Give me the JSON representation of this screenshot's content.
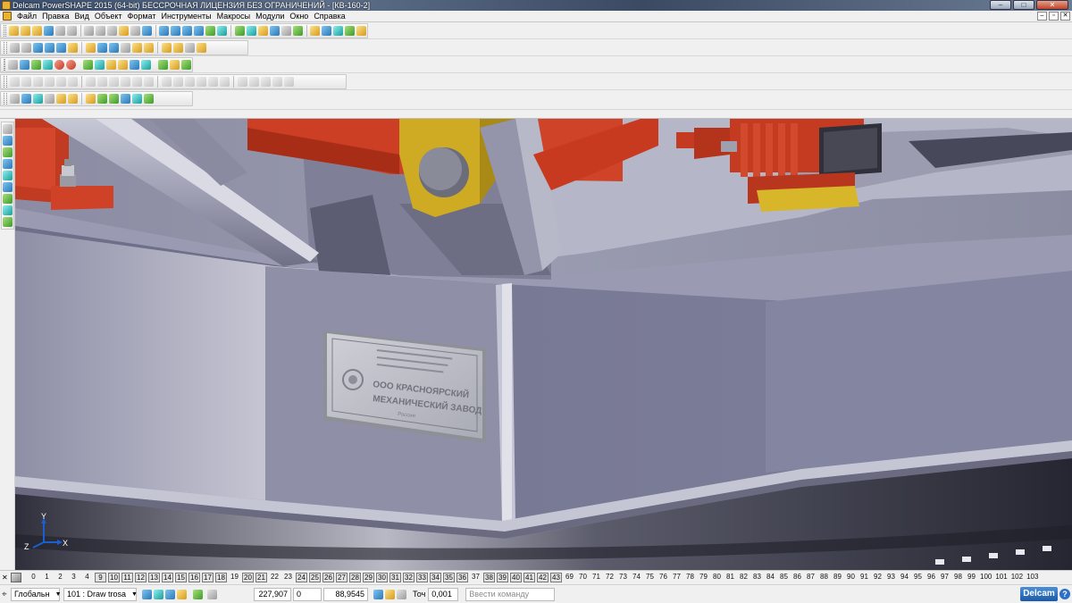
{
  "window": {
    "title": "Delcam PowerSHAPE 2015 (64-bit) БЕССРОЧНАЯ ЛИЦЕНЗИЯ БЕЗ ОГРАНИЧЕНИЙ - [КВ-160-2]",
    "minimize": "–",
    "maximize": "□",
    "close": "✕"
  },
  "menu": {
    "items": [
      "Файл",
      "Правка",
      "Вид",
      "Объект",
      "Формат",
      "Инструменты",
      "Макросы",
      "Модули",
      "Окно",
      "Справка"
    ],
    "doc_minimize": "–",
    "doc_restore": "▫",
    "doc_close": "✕"
  },
  "toolbars": {
    "row1_icons": [
      "new-file",
      "open-file",
      "open-folder",
      "save",
      "print",
      "cut",
      "copy",
      "paste",
      "delete",
      "undo",
      "redo",
      "select",
      "arc",
      "circle",
      "line",
      "spline",
      "surface",
      "solid",
      "import",
      "export",
      "help"
    ],
    "row2_icons": [
      "view-top",
      "view-front",
      "view-side",
      "view-iso",
      "zoom-in",
      "zoom-out",
      "zoom-all",
      "zoom-box",
      "pan",
      "rotate",
      "shading",
      "wireframe",
      "light",
      "render"
    ],
    "row3_icons": [
      "level",
      "layer",
      "workplane",
      "material",
      "color",
      "analysis",
      "section",
      "measure",
      "label",
      "dimension",
      "text",
      "image",
      "mesh",
      "assembly",
      "tools"
    ],
    "row4_icons": [
      "solid-box",
      "solid-cylinder",
      "solid-cone",
      "solid-sphere",
      "extrude",
      "revolve",
      "boolean",
      "fillet",
      "chamfer",
      "shell",
      "draft",
      "pattern",
      "mirror",
      "offset",
      "split",
      "merge",
      "feature"
    ],
    "row5_icons": [
      "sphere",
      "axis",
      "shaded-block",
      "wire-block",
      "gear-a",
      "gear-b",
      "gear-c",
      "curve-a",
      "curve-b",
      "cube-a",
      "cube-b",
      "check"
    ]
  },
  "left_toolbar": {
    "icons": [
      "select-arrow",
      "rotate-view",
      "solid-green",
      "cube-blue",
      "cube-teal",
      "surface-blue",
      "curve-green",
      "surface-cyan",
      "surface-green"
    ]
  },
  "viewport": {
    "nameplate": {
      "line1": "ООО КРАСНОЯРСКИЙ",
      "line2": "МЕХАНИЧЕСКИЙ ЗАВОД",
      "small_text": "Россия"
    },
    "axes": {
      "y": "Y",
      "x": "X",
      "z": "Z"
    },
    "colors": {
      "steel": "#8d8ea6",
      "red": "#c8341d",
      "yellow": "#c9a821"
    }
  },
  "levels": {
    "items": [
      {
        "n": "0",
        "on": false
      },
      {
        "n": "1",
        "on": false
      },
      {
        "n": "2",
        "on": false
      },
      {
        "n": "3",
        "on": false
      },
      {
        "n": "4",
        "on": false
      },
      {
        "n": "9",
        "on": true
      },
      {
        "n": "10",
        "on": true
      },
      {
        "n": "11",
        "on": true
      },
      {
        "n": "12",
        "on": true
      },
      {
        "n": "13",
        "on": true
      },
      {
        "n": "14",
        "on": true
      },
      {
        "n": "15",
        "on": true
      },
      {
        "n": "16",
        "on": true
      },
      {
        "n": "17",
        "on": true
      },
      {
        "n": "18",
        "on": true
      },
      {
        "n": "19",
        "on": false
      },
      {
        "n": "20",
        "on": true
      },
      {
        "n": "21",
        "on": true
      },
      {
        "n": "22",
        "on": false
      },
      {
        "n": "23",
        "on": false
      },
      {
        "n": "24",
        "on": true
      },
      {
        "n": "25",
        "on": true
      },
      {
        "n": "26",
        "on": true
      },
      {
        "n": "27",
        "on": true
      },
      {
        "n": "28",
        "on": true
      },
      {
        "n": "29",
        "on": true
      },
      {
        "n": "30",
        "on": true
      },
      {
        "n": "31",
        "on": true
      },
      {
        "n": "32",
        "on": true
      },
      {
        "n": "33",
        "on": true
      },
      {
        "n": "34",
        "on": true
      },
      {
        "n": "35",
        "on": true
      },
      {
        "n": "36",
        "on": true
      },
      {
        "n": "37",
        "on": false
      },
      {
        "n": "38",
        "on": true
      },
      {
        "n": "39",
        "on": true
      },
      {
        "n": "40",
        "on": true
      },
      {
        "n": "41",
        "on": true
      },
      {
        "n": "42",
        "on": true
      },
      {
        "n": "43",
        "on": true
      },
      {
        "n": "69",
        "on": false
      },
      {
        "n": "70",
        "on": false
      },
      {
        "n": "71",
        "on": false
      },
      {
        "n": "72",
        "on": false
      },
      {
        "n": "73",
        "on": false
      },
      {
        "n": "74",
        "on": false
      },
      {
        "n": "75",
        "on": false
      },
      {
        "n": "76",
        "on": false
      },
      {
        "n": "77",
        "on": false
      },
      {
        "n": "78",
        "on": false
      },
      {
        "n": "79",
        "on": false
      },
      {
        "n": "80",
        "on": false
      },
      {
        "n": "81",
        "on": false
      },
      {
        "n": "82",
        "on": false
      },
      {
        "n": "83",
        "on": false
      },
      {
        "n": "84",
        "on": false
      },
      {
        "n": "85",
        "on": false
      },
      {
        "n": "86",
        "on": false
      },
      {
        "n": "87",
        "on": false
      },
      {
        "n": "88",
        "on": false
      },
      {
        "n": "89",
        "on": false
      },
      {
        "n": "90",
        "on": false
      },
      {
        "n": "91",
        "on": false
      },
      {
        "n": "92",
        "on": false
      },
      {
        "n": "93",
        "on": false
      },
      {
        "n": "94",
        "on": false
      },
      {
        "n": "95",
        "on": false
      },
      {
        "n": "96",
        "on": false
      },
      {
        "n": "97",
        "on": false
      },
      {
        "n": "98",
        "on": false
      },
      {
        "n": "99",
        "on": false
      },
      {
        "n": "100",
        "on": false
      },
      {
        "n": "101",
        "on": false
      },
      {
        "n": "102",
        "on": false
      },
      {
        "n": "103",
        "on": false
      }
    ]
  },
  "status": {
    "coord_system": "Глобальн",
    "level": "101 : Draw trosa",
    "x": "227,907",
    "y": "0",
    "z": "88,9545",
    "tolerance_label": "Точ",
    "tolerance": "0,001",
    "command_placeholder": "Ввести команду",
    "logo": "Delcam",
    "help": "?"
  }
}
